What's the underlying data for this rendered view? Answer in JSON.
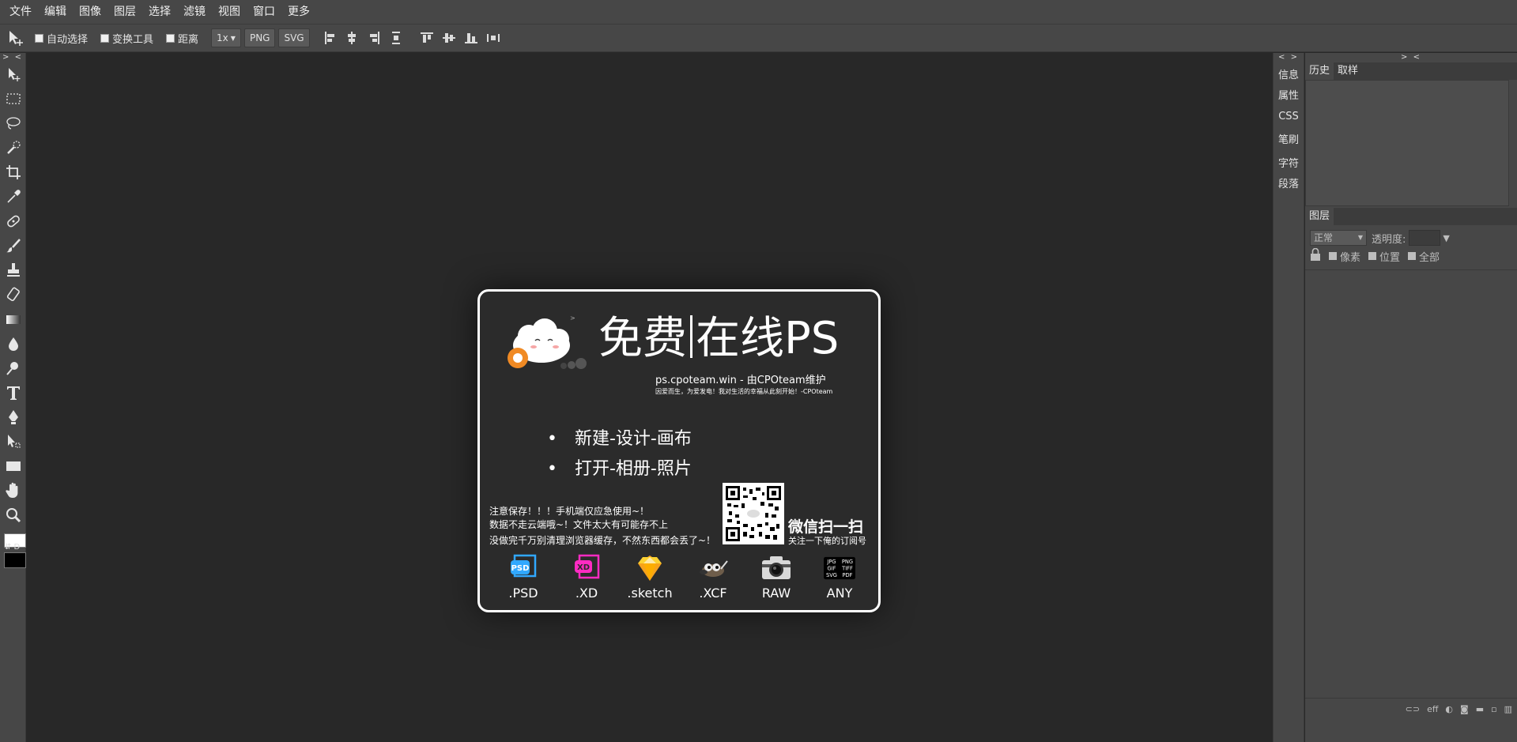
{
  "menu": [
    "文件",
    "编辑",
    "图像",
    "图层",
    "选择",
    "滤镜",
    "视图",
    "窗口",
    "更多"
  ],
  "options": {
    "auto_select": "自动选择",
    "transform_tool": "变换工具",
    "distance": "距离",
    "zoom": "1x",
    "png": "PNG",
    "svg": "SVG"
  },
  "collapse_left": "> <",
  "collapse_strip": "< >",
  "collapse_panel": "> <",
  "tools": [
    "move-tool-icon",
    "marquee-tool-icon",
    "lasso-tool-icon",
    "quick-select-tool-icon",
    "crop-tool-icon",
    "eyedropper-tool-icon",
    "healing-brush-icon",
    "brush-tool-icon",
    "clone-stamp-icon",
    "eraser-tool-icon",
    "gradient-tool-icon",
    "blur-tool-icon",
    "dodge-tool-icon",
    "text-tool-icon",
    "pen-tool-icon",
    "path-select-icon",
    "shape-tool-icon",
    "hand-tool-icon",
    "zoom-tool-icon"
  ],
  "swatch_labels": "⇵ D",
  "welcome": {
    "brand_left": "免费",
    "brand_right": "在线PS",
    "site": "ps.cpoteam.win - 由CPOteam维护",
    "tagline": "因爱而生，为爱发电！我对生活的幸福从此刻开始！-CPOteam",
    "bullets": [
      "新建-设计-画布",
      "打开-相册-照片"
    ],
    "note1": "注意保存！！！手机端仅应急使用~！",
    "note2": "数据不走云端哦~！文件太大有可能存不上",
    "note3": "没做完千万别清理浏览器缓存，不然东西都会丢了~！",
    "scan_title": "微信扫一扫",
    "scan_sub": "关注一下俺的订阅号",
    "formats": [
      ".PSD",
      ".XD",
      ".sketch",
      ".XCF",
      "RAW",
      "ANY"
    ],
    "psd_badge": "PSD",
    "xd_badge": "XD",
    "any_formats": [
      "JPG",
      "PNG",
      "GIF",
      "TIFF",
      "SVG",
      "PDF"
    ]
  },
  "strip_tabs": [
    "信息",
    "属性",
    "CSS",
    "笔刷",
    "字符",
    "段落"
  ],
  "history_tabs": [
    "历史",
    "取样"
  ],
  "layers": {
    "tab": "图层",
    "blend_mode": "正常",
    "opacity_label": "透明度:",
    "lock_pixels": "像素",
    "lock_position": "位置",
    "lock_all": "全部",
    "footer_link": "eff"
  },
  "colors": {
    "ui_bg": "#474747",
    "canvas_bg": "#282828",
    "foreground": "#ffffff",
    "background": "#000000",
    "psd_blue": "#31a8ff",
    "xd_pink": "#ff2bc2",
    "sketch_orange": "#f7a21b"
  }
}
